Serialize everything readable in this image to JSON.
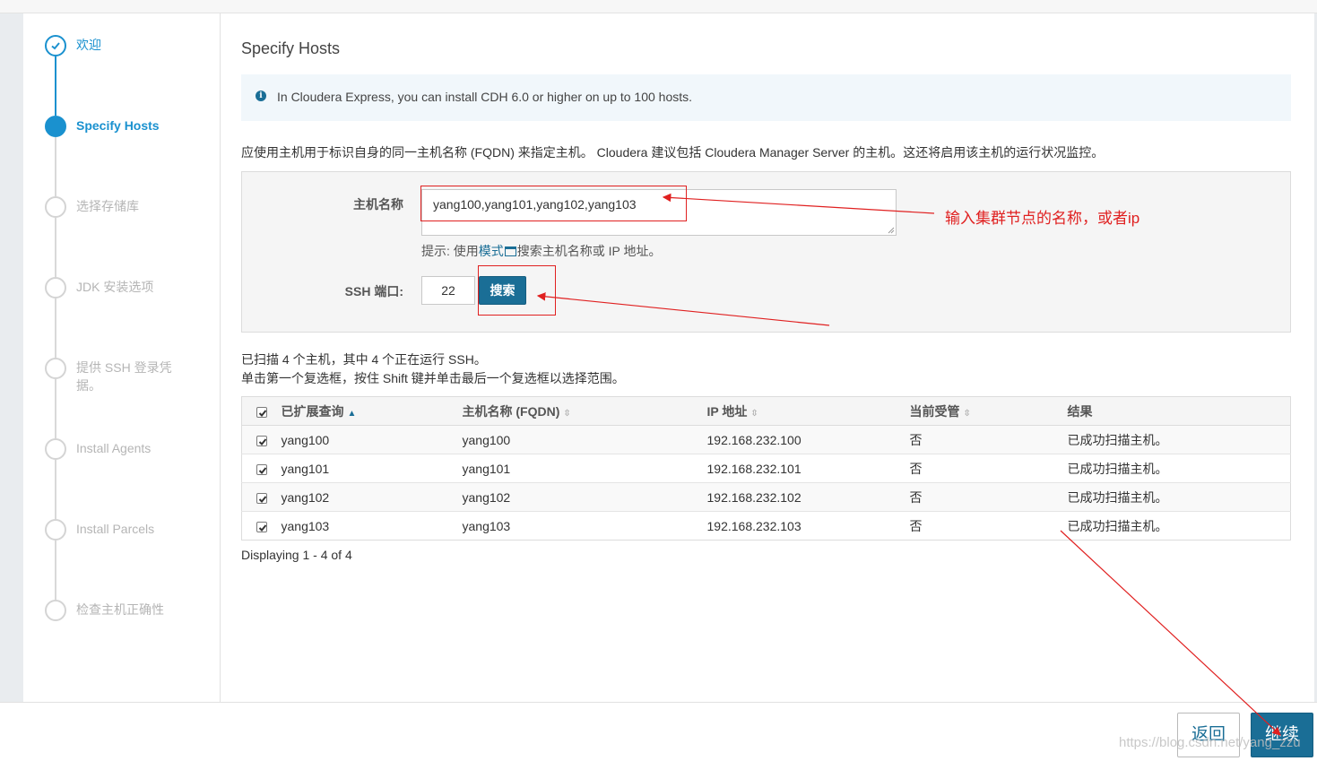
{
  "steps": [
    {
      "label": "欢迎",
      "state": "done"
    },
    {
      "label": "Specify Hosts",
      "state": "active"
    },
    {
      "label": "选择存储库",
      "state": "pending"
    },
    {
      "label": "JDK 安装选项",
      "state": "pending"
    },
    {
      "label": "提供 SSH 登录凭据。",
      "state": "pending"
    },
    {
      "label": "Install Agents",
      "state": "pending"
    },
    {
      "label": "Install Parcels",
      "state": "pending"
    },
    {
      "label": "检查主机正确性",
      "state": "pending"
    }
  ],
  "main": {
    "title": "Specify Hosts",
    "info": "In Cloudera Express, you can install CDH 6.0 or higher on up to 100 hosts.",
    "description": "应使用主机用于标识自身的同一主机名称 (FQDN) 来指定主机。 Cloudera 建议包括 Cloudera Manager Server 的主机。这还将启用该主机的运行状况监控。"
  },
  "form": {
    "hostname_label": "主机名称",
    "hostname_value": "yang100,yang101,yang102,yang103",
    "hint_prefix": "提示: 使用",
    "hint_link": "模式",
    "hint_suffix": "搜索主机名称或 IP 地址。",
    "ssh_port_label": "SSH 端口:",
    "ssh_port_value": "22",
    "search_label": "搜索"
  },
  "scan": {
    "summary": "已扫描 4 个主机，其中 4 个正在运行 SSH。",
    "help": "单击第一个复选框，按住 Shift 键并单击最后一个复选框以选择范围。"
  },
  "table": {
    "headers": [
      "已扩展查询",
      "主机名称 (FQDN)",
      "IP 地址",
      "当前受管",
      "结果"
    ],
    "rows": [
      {
        "expanded": "yang100",
        "fqdn": "yang100",
        "ip": "192.168.232.100",
        "managed": "否",
        "result": "已成功扫描主机。"
      },
      {
        "expanded": "yang101",
        "fqdn": "yang101",
        "ip": "192.168.232.101",
        "managed": "否",
        "result": "已成功扫描主机。"
      },
      {
        "expanded": "yang102",
        "fqdn": "yang102",
        "ip": "192.168.232.102",
        "managed": "否",
        "result": "已成功扫描主机。"
      },
      {
        "expanded": "yang103",
        "fqdn": "yang103",
        "ip": "192.168.232.103",
        "managed": "否",
        "result": "已成功扫描主机。"
      }
    ],
    "displaying": "Displaying 1 - 4 of 4"
  },
  "footer": {
    "back_label": "返回",
    "continue_label": "继续",
    "watermark": "https://blog.csdn.net/yang_zzu"
  },
  "annotation": {
    "text": "输入集群节点的名称，或者ip",
    "color": "#e02020"
  },
  "colors": {
    "accent": "#1a91cf",
    "button": "#1a6e96"
  }
}
